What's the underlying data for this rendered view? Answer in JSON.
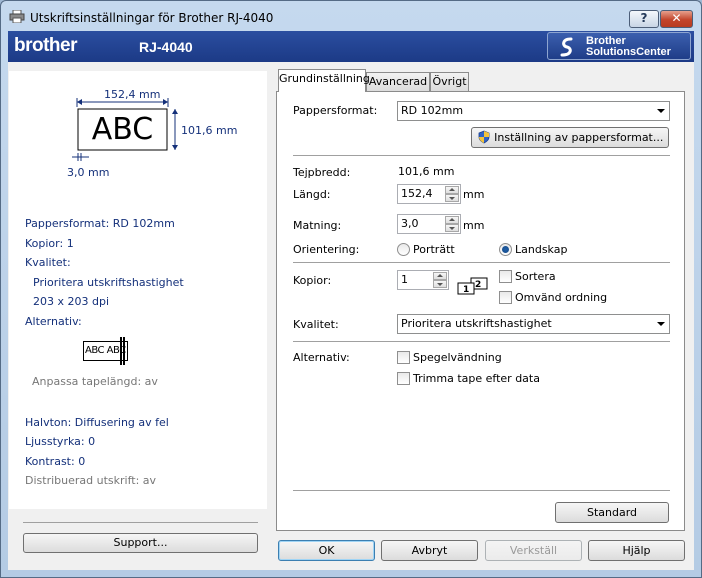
{
  "window": {
    "title": "Utskriftsinställningar för Brother RJ-4040",
    "help_label": "?",
    "close_label": "✕"
  },
  "banner": {
    "logo": "brother",
    "model": "RJ-4040",
    "solutions_line1": "Brother",
    "solutions_line2": "SolutionsCenter"
  },
  "preview": {
    "width_label": "152,4 mm",
    "height_label": "101,6 mm",
    "margin_label": "3,0 mm",
    "sample_text": "ABC",
    "summary": {
      "paper_format": "Pappersformat: RD 102mm",
      "copies": "Kopior: 1",
      "quality_label": "Kvalitet:",
      "quality_value": "Prioritera utskriftshastighet",
      "resolution": "203 x 203 dpi",
      "options_label": "Alternativ:",
      "mirror_sample": "ABC ABC",
      "autofit": "Anpassa tapelängd: av",
      "halftone": "Halvton: Diffusering av fel",
      "brightness": "Ljusstyrka:   0",
      "contrast": "Kontrast:   0",
      "distributed": "Distribuerad utskrift: av"
    },
    "support_label": "Support..."
  },
  "tabs": [
    {
      "label": "Grundinställning",
      "active": true
    },
    {
      "label": "Avancerad",
      "active": false
    },
    {
      "label": "Övrigt",
      "active": false
    }
  ],
  "basic": {
    "paper_format_label": "Pappersformat:",
    "paper_format_value": "RD 102mm",
    "paper_settings_button": "Inställning av pappersformat...",
    "tape_width_label": "Tejpbredd:",
    "tape_width_value": "101,6 mm",
    "length_label": "Längd:",
    "length_value": "152,4",
    "length_unit": "mm",
    "feed_label": "Matning:",
    "feed_value": "3,0",
    "feed_unit": "mm",
    "orientation_label": "Orientering:",
    "portrait_label": "Porträtt",
    "landscape_label": "Landskap",
    "orientation_selected": "landscape",
    "copies_label": "Kopior:",
    "copies_value": "1",
    "collate_label": "Sortera",
    "reverse_label": "Omvänd ordning",
    "quality_label": "Kvalitet:",
    "quality_value": "Prioritera utskriftshastighet",
    "options_label": "Alternativ:",
    "mirror_label": "Spegelvändning",
    "trim_label": "Trimma tape efter data",
    "default_button": "Standard"
  },
  "footer": {
    "ok": "OK",
    "cancel": "Avbryt",
    "apply": "Verkställ",
    "help": "Hjälp"
  }
}
